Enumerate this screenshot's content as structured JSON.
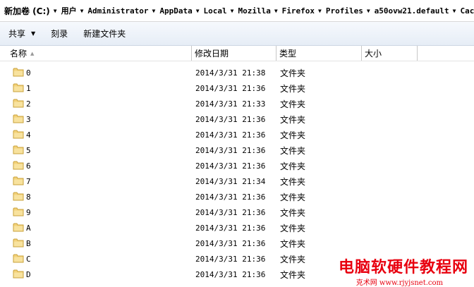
{
  "breadcrumb": [
    {
      "label": "新加卷 (C:)"
    },
    {
      "label": "用户"
    },
    {
      "label": "Administrator"
    },
    {
      "label": "AppData"
    },
    {
      "label": "Local"
    },
    {
      "label": "Mozilla"
    },
    {
      "label": "Firefox"
    },
    {
      "label": "Profiles"
    },
    {
      "label": "a50ovw21.default"
    },
    {
      "label": "Cache"
    }
  ],
  "toolbar": {
    "share_label": "共享",
    "burn_label": "刻录",
    "new_folder_label": "新建文件夹"
  },
  "columns": {
    "name": "名称",
    "date_modified": "修改日期",
    "type": "类型",
    "size": "大小"
  },
  "rows": [
    {
      "name": "0",
      "date": "2014/3/31 21:38",
      "type": "文件夹"
    },
    {
      "name": "1",
      "date": "2014/3/31 21:36",
      "type": "文件夹"
    },
    {
      "name": "2",
      "date": "2014/3/31 21:33",
      "type": "文件夹"
    },
    {
      "name": "3",
      "date": "2014/3/31 21:36",
      "type": "文件夹"
    },
    {
      "name": "4",
      "date": "2014/3/31 21:36",
      "type": "文件夹"
    },
    {
      "name": "5",
      "date": "2014/3/31 21:36",
      "type": "文件夹"
    },
    {
      "name": "6",
      "date": "2014/3/31 21:36",
      "type": "文件夹"
    },
    {
      "name": "7",
      "date": "2014/3/31 21:34",
      "type": "文件夹"
    },
    {
      "name": "8",
      "date": "2014/3/31 21:36",
      "type": "文件夹"
    },
    {
      "name": "9",
      "date": "2014/3/31 21:36",
      "type": "文件夹"
    },
    {
      "name": "A",
      "date": "2014/3/31 21:36",
      "type": "文件夹"
    },
    {
      "name": "B",
      "date": "2014/3/31 21:36",
      "type": "文件夹"
    },
    {
      "name": "C",
      "date": "2014/3/31 21:36",
      "type": "文件夹"
    },
    {
      "name": "D",
      "date": "2014/3/31 21:36",
      "type": "文件夹"
    }
  ],
  "watermark": {
    "title": "电脑软硬件教程网",
    "url": "克术网 www.rjyjsnet.com"
  },
  "colors": {
    "folder_fill": "#f3d27a",
    "folder_edge": "#c9a13a",
    "watermark": "#e8000f"
  },
  "icons": {
    "folder": "folder-icon",
    "crumb_arrow": "chevron-down-icon",
    "sort": "sort-arrow-icon"
  }
}
